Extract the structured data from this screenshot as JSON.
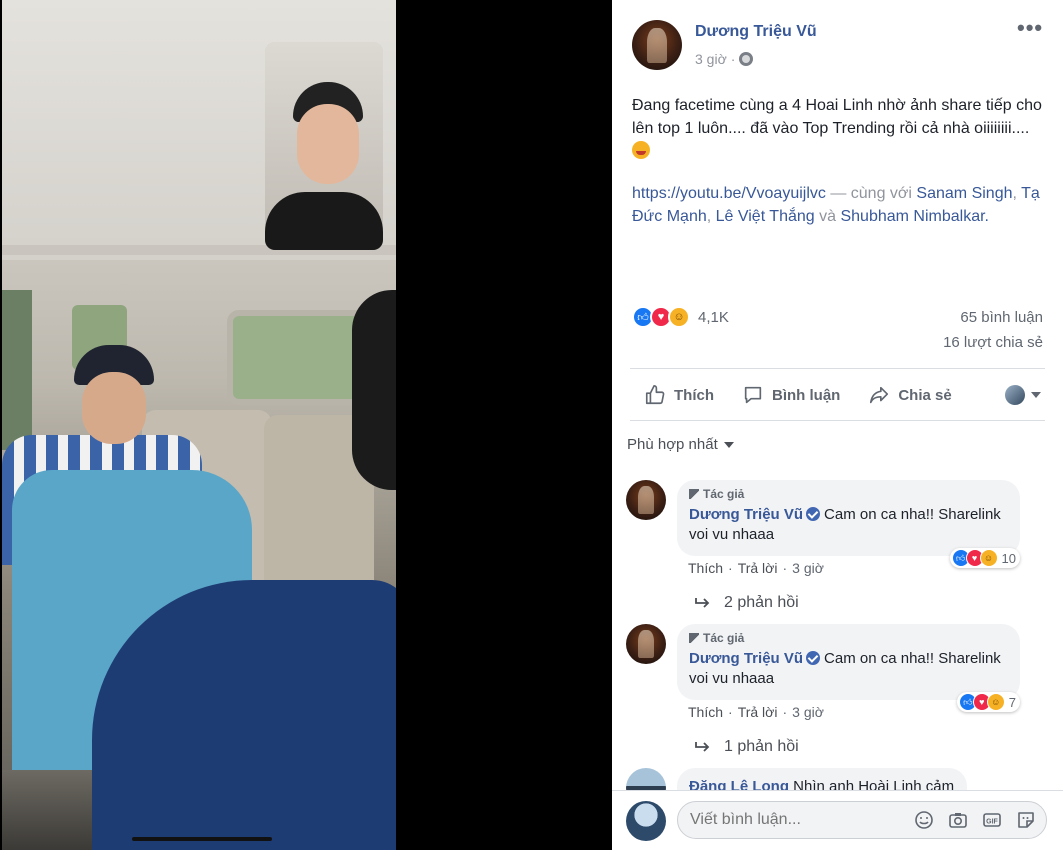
{
  "post": {
    "author": "Dương Triệu Vũ",
    "time": "3 giờ",
    "more": "•••",
    "text": "Đang facetime cùng a 4 Hoai Linh nhờ ảnh share tiếp cho lên top 1 luôn.... đã vào Top Trending rồi cả nhà oiiiiiiii....",
    "emoji": "squinting-tongue-face",
    "link": "https://youtu.be/Vvoayuijlvc",
    "with_prefix": " — cùng với ",
    "tags": [
      "Sanam Singh",
      "Tạ Đức Mạnh",
      "Lê Việt Thắng",
      "Shubham Nimbalkar"
    ],
    "sep1": ", ",
    "sep2": ", ",
    "and_word": " và ",
    "end": "."
  },
  "reactions": {
    "icons": [
      "like",
      "love",
      "haha"
    ],
    "count": "4,1K",
    "comments": "65 bình luận",
    "shares": "16 lượt chia sẻ"
  },
  "actions": {
    "like": "Thích",
    "comment": "Bình luận",
    "share": "Chia sẻ"
  },
  "sort": {
    "label": "Phù hợp nhất"
  },
  "comments": [
    {
      "badge": "Tác giả",
      "name": "Dương Triệu Vũ",
      "text": "Cam on ca nha!! Sharelink voi vu nhaaa",
      "react_count": "10",
      "like": "Thích",
      "reply": "Trả lời",
      "time": "3 giờ",
      "dot": "·",
      "replies": "2 phản hồi"
    },
    {
      "badge": "Tác giả",
      "name": "Dương Triệu Vũ",
      "text": "Cam on ca nha!! Sharelink voi vu nhaaa",
      "react_count": "7",
      "like": "Thích",
      "reply": "Trả lời",
      "time": "3 giờ",
      "dot": "·",
      "replies": "1 phản hồi"
    },
    {
      "name": "Đặng Lê Long",
      "text": "Nhìn anh Hoài Linh cảm"
    }
  ],
  "composer": {
    "placeholder": "Viết bình luận..."
  },
  "colors": {
    "link": "#385898",
    "meta": "#90949c",
    "text": "#1d2129"
  }
}
